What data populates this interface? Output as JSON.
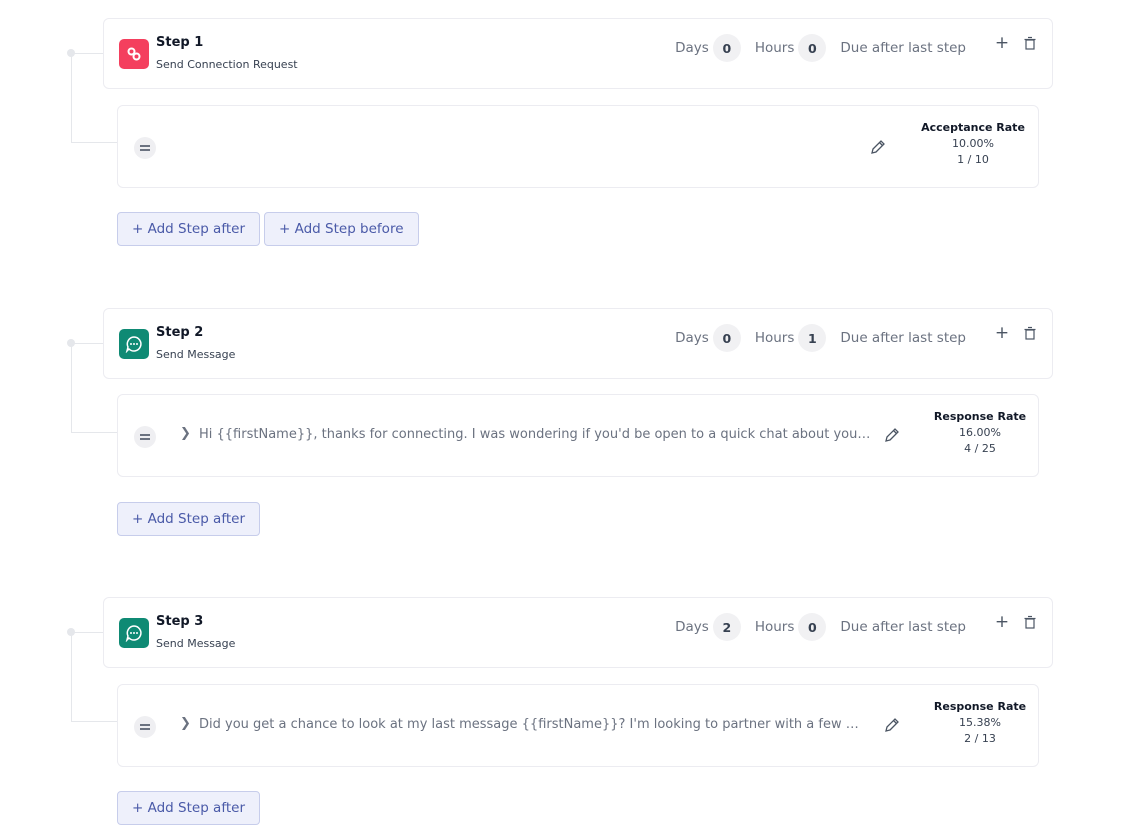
{
  "header_labels": {
    "days": "Days",
    "hours": "Hours",
    "due": "Due after last step"
  },
  "steps": [
    {
      "title": "Step 1",
      "subtitle": "Send Connection Request",
      "icon": "link-icon",
      "days": "0",
      "hours": "0",
      "message": "",
      "rate_label": "Acceptance Rate",
      "rate_value": "10.00%",
      "rate_count": "1 / 10",
      "add_after": "+ Add Step after",
      "add_before": "+ Add Step before"
    },
    {
      "title": "Step 2",
      "subtitle": "Send Message",
      "icon": "chat-icon",
      "days": "0",
      "hours": "1",
      "message": "Hi {{firstName}}, thanks for connecting. I was wondering if you'd be open to a quick chat about your work and how we might collaborate together on something interesting",
      "rate_label": "Response Rate",
      "rate_value": "16.00%",
      "rate_count": "4 / 25",
      "add_after": "+ Add Step after"
    },
    {
      "title": "Step 3",
      "subtitle": "Send Message",
      "icon": "chat-icon",
      "days": "2",
      "hours": "0",
      "message": "Did you get a chance to look at my last message {{firstName}}? I'm looking to partner with a few more people this month",
      "rate_label": "Response Rate",
      "rate_value": "15.38%",
      "rate_count": "2 / 13",
      "add_after": "+ Add Step after"
    }
  ],
  "colors": {
    "connection_icon_bg": "#f43f5e",
    "message_icon_bg": "#0f8a74",
    "add_button_text": "#4a5aa8",
    "add_button_bg": "#eef0fb"
  }
}
